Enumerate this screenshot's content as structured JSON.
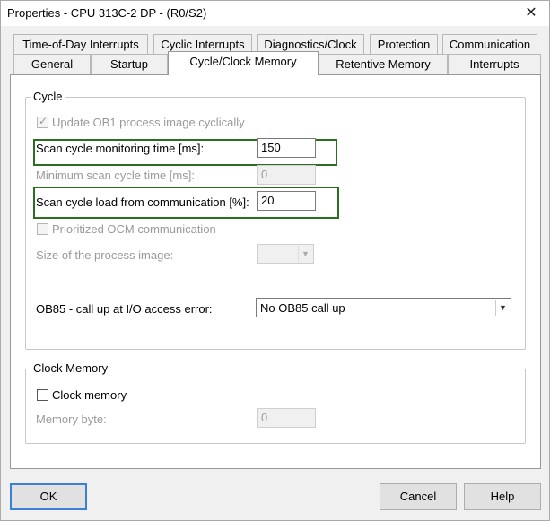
{
  "window": {
    "title": "Properties - CPU 313C-2 DP - (R0/S2)",
    "close_glyph": "✕"
  },
  "tabs": {
    "row1": [
      "Time-of-Day Interrupts",
      "Cyclic Interrupts",
      "Diagnostics/Clock",
      "Protection",
      "Communication"
    ],
    "row2": [
      "General",
      "Startup",
      "Cycle/Clock Memory",
      "Retentive Memory",
      "Interrupts"
    ],
    "active": "Cycle/Clock Memory"
  },
  "cycle": {
    "group_label": "Cycle",
    "update_ob1_label": "Update OB1 process image cyclically",
    "update_ob1_checked": true,
    "scan_monitoring_label": "Scan cycle monitoring time [ms]:",
    "scan_monitoring_value": "150",
    "min_scan_label": "Minimum scan cycle time [ms]:",
    "min_scan_value": "0",
    "load_comm_label": "Scan cycle load from communication [%]:",
    "load_comm_value": "20",
    "prioritized_ocm_label": "Prioritized OCM communication",
    "prioritized_ocm_checked": false,
    "process_image_label": "Size of the process image:",
    "process_image_value": "",
    "ob85_label": "OB85 - call up at I/O access error:",
    "ob85_value": "No OB85 call up",
    "highlight_color": "#2c6e1f"
  },
  "clock": {
    "group_label": "Clock Memory",
    "clock_memory_label": "Clock memory",
    "clock_memory_checked": false,
    "memory_byte_label": "Memory byte:",
    "memory_byte_value": "0"
  },
  "buttons": {
    "ok": "OK",
    "cancel": "Cancel",
    "help": "Help"
  }
}
